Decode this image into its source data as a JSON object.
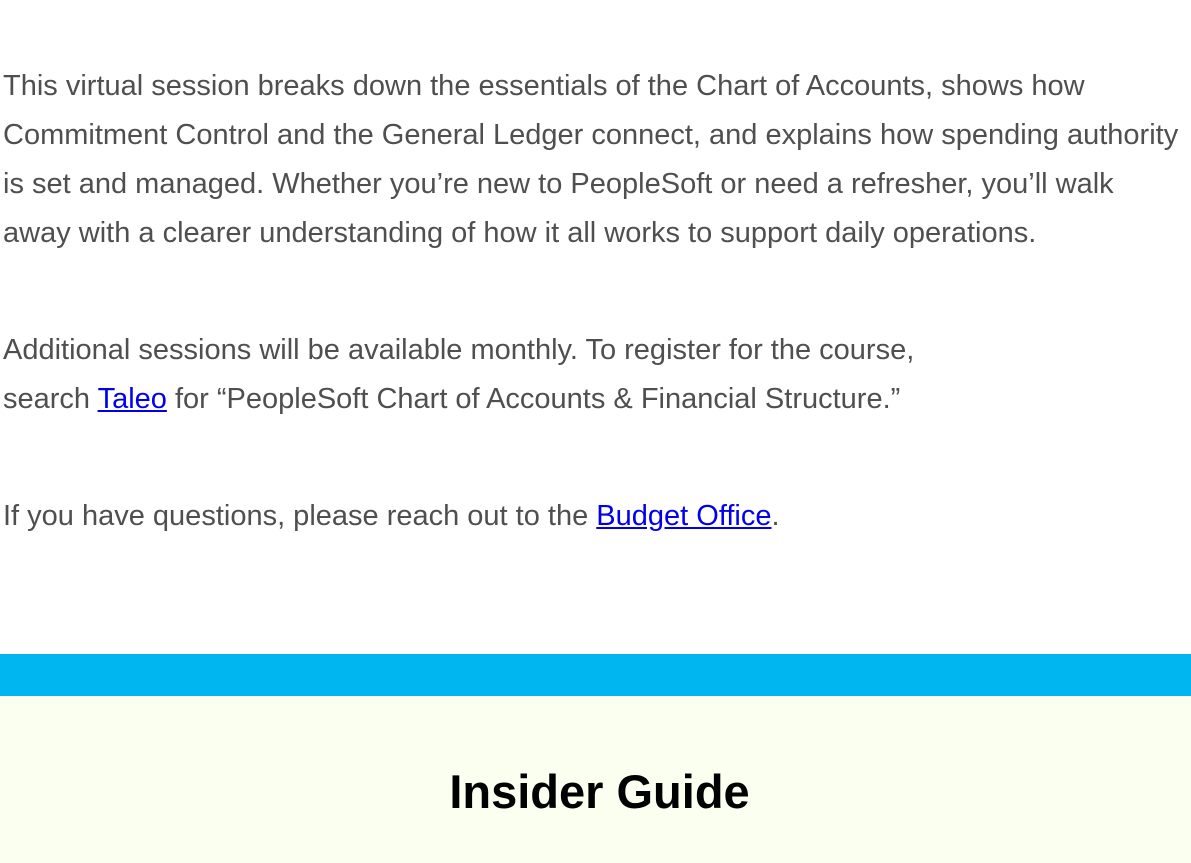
{
  "colors": {
    "text": "#4f4f4f",
    "link": "#0000ee",
    "banner": "#00b6f0",
    "guide_bg": "#fbfff0",
    "heading": "#000000"
  },
  "intro": {
    "text": "This virtual session breaks down the essentials of the Chart of Accounts, shows how Commitment Control and the General Ledger connect, and explains how spending authority is set and managed. Whether you’re new to PeopleSoft or need a refresher, you’ll walk away with a clearer understanding of how it all works to support daily operations."
  },
  "register": {
    "line1": "Additional sessions will be available monthly. To register for the course,",
    "before_link": "search ",
    "link_text": "Taleo",
    "after_link": " for “PeopleSoft Chart of Accounts & Financial Structure.”"
  },
  "questions": {
    "before_link": "If you have questions, please reach out to the ",
    "link_text": "Budget Office",
    "after_link": "."
  },
  "guide": {
    "title": "Insider Guide"
  }
}
